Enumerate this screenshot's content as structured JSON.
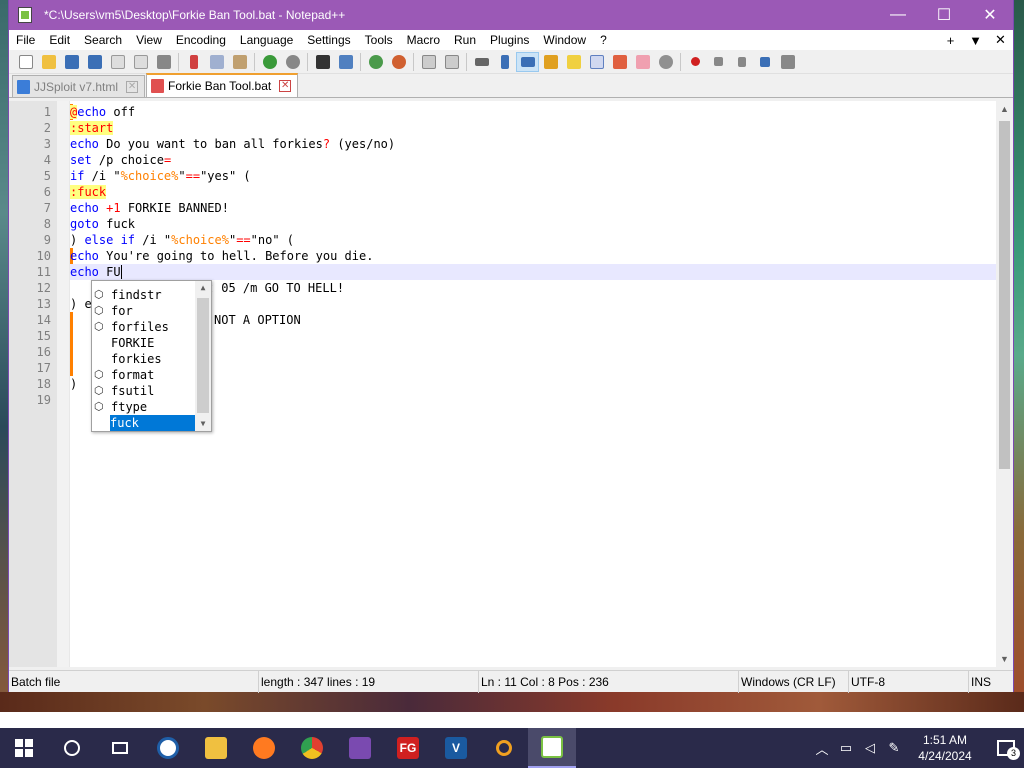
{
  "window": {
    "title": "*C:\\Users\\vm5\\Desktop\\Forkie Ban Tool.bat - Notepad++",
    "minimize": "—",
    "maximize": "☐",
    "close": "✕"
  },
  "menu": [
    "File",
    "Edit",
    "Search",
    "View",
    "Encoding",
    "Language",
    "Settings",
    "Tools",
    "Macro",
    "Run",
    "Plugins",
    "Window",
    "?"
  ],
  "menu_right": {
    "plus": "+",
    "down": "▼",
    "close": "✕"
  },
  "tabs": [
    {
      "label": "JJSploit v7.html",
      "close": "✕",
      "color": "#3b7dd8"
    },
    {
      "label": "Forkie Ban Tool.bat",
      "close": "✕",
      "color": "#e05050"
    }
  ],
  "line_numbers": [
    "1",
    "2",
    "3",
    "4",
    "5",
    "6",
    "7",
    "8",
    "9",
    "10",
    "11",
    "12",
    "13",
    "14",
    "15",
    "16",
    "17",
    "18",
    "19"
  ],
  "code": {
    "l1_at": "@",
    "l1_kw": "echo",
    "l1_rest": " off",
    "l2": ":start",
    "l3_kw": "echo",
    "l3_rest": " Do you want to ban all forkies",
    "l3_q": "?",
    "l3_tail": " (yes/no)",
    "l4_kw": "set",
    "l4_rest": " /p choice",
    "l4_op": "=",
    "l5_kw": "if",
    "l5_a": " /i \"",
    "l5_var": "%choice%",
    "l5_b": "\"",
    "l5_op": "==",
    "l5_c": "\"yes\" (",
    "l6": ":fuck",
    "l7_kw": "echo",
    "l7_op": " +1",
    "l7_rest": " FORKIE BANNED!",
    "l8_kw": "goto",
    "l8_rest": " fuck",
    "l9_a": ") ",
    "l9_kw": "else if",
    "l9_b": " /i \"",
    "l9_var": "%choice%",
    "l9_c": "\"",
    "l9_op": "==",
    "l9_d": "\"no\" (",
    "l10_kw": "echo",
    "l10_rest": " You're going to hell. Before you die.",
    "l11_kw": "echo",
    "l11_rest": " FU",
    "l12_rest": "05 /m GO TO HELL!",
    "l12_t": "t",
    "l13": ") e",
    "l14": "NOT A OPTION",
    "l18": ")"
  },
  "autocomplete": [
    {
      "label": "findstr",
      "icon": true
    },
    {
      "label": "for",
      "icon": true
    },
    {
      "label": "forfiles",
      "icon": true
    },
    {
      "label": "FORKIE",
      "icon": false
    },
    {
      "label": "forkies",
      "icon": false
    },
    {
      "label": "format",
      "icon": true
    },
    {
      "label": "fsutil",
      "icon": true
    },
    {
      "label": "ftype",
      "icon": true
    },
    {
      "label": "fuck",
      "icon": false,
      "selected": true
    }
  ],
  "status": {
    "lang": "Batch file",
    "length": "length : 347    lines : 19",
    "pos": "Ln : 11    Col : 8    Pos : 236",
    "eol": "Windows (CR LF)",
    "enc": "UTF-8",
    "mode": "INS"
  },
  "taskbar": {
    "apps": [
      "start",
      "search",
      "task-view",
      "obama",
      "file-explorer",
      "firefox",
      "chrome",
      "visual-studio",
      "fg",
      "v",
      "search-app",
      "notepadpp"
    ],
    "fg_label": "FG",
    "v_label": "V",
    "time": "1:51 AM",
    "date": "4/24/2024",
    "notif_count": "3"
  }
}
